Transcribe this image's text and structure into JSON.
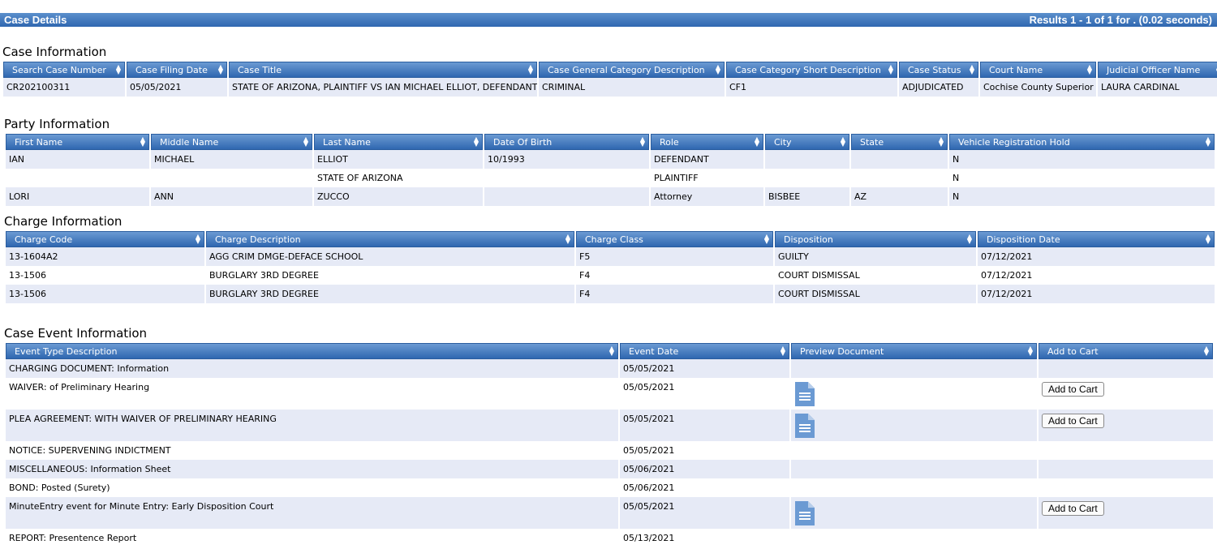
{
  "header": {
    "title": "Case Details",
    "results": "Results 1 - 1 of 1 for . (0.02 seconds)"
  },
  "case_info": {
    "title": "Case Information",
    "columns": [
      "Search Case Number",
      "Case Filing Date",
      "Case Title",
      "Case General Category Description",
      "Case Category Short Description",
      "Case Status",
      "Court Name",
      "Judicial Officer Name"
    ],
    "rows": [
      [
        "CR202100311",
        "05/05/2021",
        "STATE OF ARIZONA, PLAINTIFF VS IAN MICHAEL ELLIOT, DEFENDANT",
        "CRIMINAL",
        "CF1",
        "ADJUDICATED",
        "Cochise County Superior",
        "LAURA CARDINAL"
      ]
    ]
  },
  "party_info": {
    "title": "Party Information",
    "columns": [
      "First Name",
      "Middle Name",
      "Last Name",
      "Date Of Birth",
      "Role",
      "City",
      "State",
      "Vehicle Registration Hold"
    ],
    "rows": [
      [
        "IAN",
        "MICHAEL",
        "ELLIOT",
        "10/1993",
        "DEFENDANT",
        "",
        "",
        "N"
      ],
      [
        "",
        "",
        "STATE OF ARIZONA",
        "",
        "PLAINTIFF",
        "",
        "",
        "N"
      ],
      [
        "LORI",
        "ANN",
        "ZUCCO",
        "",
        "Attorney",
        "BISBEE",
        "AZ",
        "N"
      ]
    ]
  },
  "charge_info": {
    "title": "Charge Information",
    "columns": [
      "Charge Code",
      "Charge Description",
      "Charge Class",
      "Disposition",
      "Disposition Date"
    ],
    "rows": [
      [
        "13-1604A2",
        "AGG CRIM DMGE-DEFACE SCHOOL",
        "F5",
        "GUILTY",
        "07/12/2021"
      ],
      [
        "13-1506",
        "BURGLARY 3RD DEGREE",
        "F4",
        "COURT DISMISSAL",
        "07/12/2021"
      ],
      [
        "13-1506",
        "BURGLARY 3RD DEGREE",
        "F4",
        "COURT DISMISSAL",
        "07/12/2021"
      ]
    ]
  },
  "event_info": {
    "title": "Case Event Information",
    "columns": [
      "Event Type Description",
      "Event Date",
      "Preview Document",
      "Add to Cart"
    ],
    "add_to_cart_label": "Add to Cart",
    "rows": [
      {
        "description": "CHARGING DOCUMENT: Information",
        "date": "05/05/2021",
        "has_document": false
      },
      {
        "description": "WAIVER: of Preliminary Hearing",
        "date": "05/05/2021",
        "has_document": true
      },
      {
        "description": "PLEA AGREEMENT: WITH WAIVER OF PRELIMINARY HEARING",
        "date": "05/05/2021",
        "has_document": true
      },
      {
        "description": "NOTICE: SUPERVENING INDICTMENT",
        "date": "05/05/2021",
        "has_document": false
      },
      {
        "description": "MISCELLANEOUS: Information Sheet",
        "date": "05/06/2021",
        "has_document": false
      },
      {
        "description": "BOND: Posted (Surety)",
        "date": "05/06/2021",
        "has_document": false
      },
      {
        "description": "MinuteEntry event for Minute Entry: Early Disposition Court",
        "date": "05/05/2021",
        "has_document": true
      },
      {
        "description": "REPORT: Presentence Report",
        "date": "05/13/2021",
        "has_document": false
      }
    ]
  },
  "icons": {
    "sort": "sort-arrows-icon",
    "document": "document-icon"
  },
  "colors": {
    "header_blue": "#2f67b0",
    "row_stripe": "#e6eaf6",
    "doc_icon": "#6b9ad3"
  }
}
